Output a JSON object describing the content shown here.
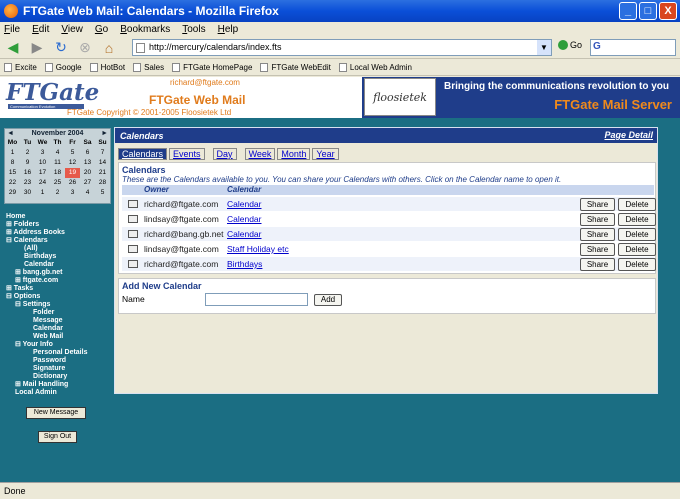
{
  "window": {
    "title": "FTGate Web Mail: Calendars - Mozilla Firefox",
    "min": "_",
    "max": "□",
    "close": "X"
  },
  "menu": [
    "File",
    "Edit",
    "View",
    "Go",
    "Bookmarks",
    "Tools",
    "Help"
  ],
  "toolbar": {
    "url": "http://mercury/calendars/index.fts",
    "go_label": "Go",
    "search_glyph": "G"
  },
  "bookmarks": [
    "Excite",
    "Google",
    "HotBot",
    "Sales",
    "FTGate HomePage",
    "FTGate WebEdit",
    "Local Web Admin"
  ],
  "header": {
    "logo": "FTGate",
    "logo_sub": "Communication Evolution",
    "email": "richard@ftgate.com",
    "app_name": "FTGate Web Mail",
    "copyright": "FTGate Copyright © 2001-2005 Floosietek Ltd",
    "floosietek": "floosietek",
    "slogan": "Bringing the communications revolution to you",
    "server": "FTGate Mail Server"
  },
  "calendar": {
    "month": "November 2004",
    "prev": "◄",
    "next": "►",
    "days": [
      "Mo",
      "Tu",
      "We",
      "Th",
      "Fr",
      "Sa",
      "Su"
    ],
    "weeks": [
      [
        "1",
        "2",
        "3",
        "4",
        "5",
        "6",
        "7"
      ],
      [
        "8",
        "9",
        "10",
        "11",
        "12",
        "13",
        "14"
      ],
      [
        "15",
        "16",
        "17",
        "18",
        "19",
        "20",
        "21"
      ],
      [
        "22",
        "23",
        "24",
        "25",
        "26",
        "27",
        "28"
      ],
      [
        "29",
        "30",
        "1",
        "2",
        "3",
        "4",
        "5"
      ]
    ],
    "today": "19"
  },
  "nav": [
    "Home",
    "⊞ Folders",
    "⊞ Address Books",
    "⊟ Calendars",
    "(All)",
    "Birthdays",
    "Calendar",
    "⊞ bang.gb.net",
    "⊞ ftgate.com",
    "⊞ Tasks",
    "⊟ Options",
    "⊟ Settings",
    "Folder",
    "Message",
    "Calendar",
    "Web Mail",
    "⊟ Your Info",
    "Personal Details",
    "Password",
    "Signature",
    "Dictionary",
    "⊞ Mail Handling",
    "Local Admin"
  ],
  "sidebar_buttons": {
    "new_message": "New Message",
    "sign_out": "Sign Out"
  },
  "main": {
    "title": "Calendars",
    "page_detail": "Page Detail",
    "tabs": [
      "Calendars",
      "Events",
      "Day",
      "Week",
      "Month",
      "Year"
    ],
    "panel_title": "Calendars",
    "description": "These are the Calendars available to you. You can share your Calendars with others. Click on the Calendar name to open it.",
    "col_owner": "Owner",
    "col_calendar": "Calendar",
    "rows": [
      {
        "owner": "richard@ftgate.com",
        "calendar": "Calendar",
        "share": "Share",
        "delete": "Delete"
      },
      {
        "owner": "lindsay@ftgate.com",
        "calendar": "Calendar",
        "share": "Share",
        "delete": "Delete"
      },
      {
        "owner": "richard@bang.gb.net",
        "calendar": "Calendar",
        "share": "Share",
        "delete": "Delete"
      },
      {
        "owner": "lindsay@ftgate.com",
        "calendar": "Staff Holiday etc",
        "share": "Share",
        "delete": "Delete"
      },
      {
        "owner": "richard@ftgate.com",
        "calendar": "Birthdays",
        "share": "Share",
        "delete": "Delete"
      }
    ],
    "add_title": "Add New Calendar",
    "add_name_label": "Name",
    "add_button": "Add"
  },
  "status": "Done"
}
